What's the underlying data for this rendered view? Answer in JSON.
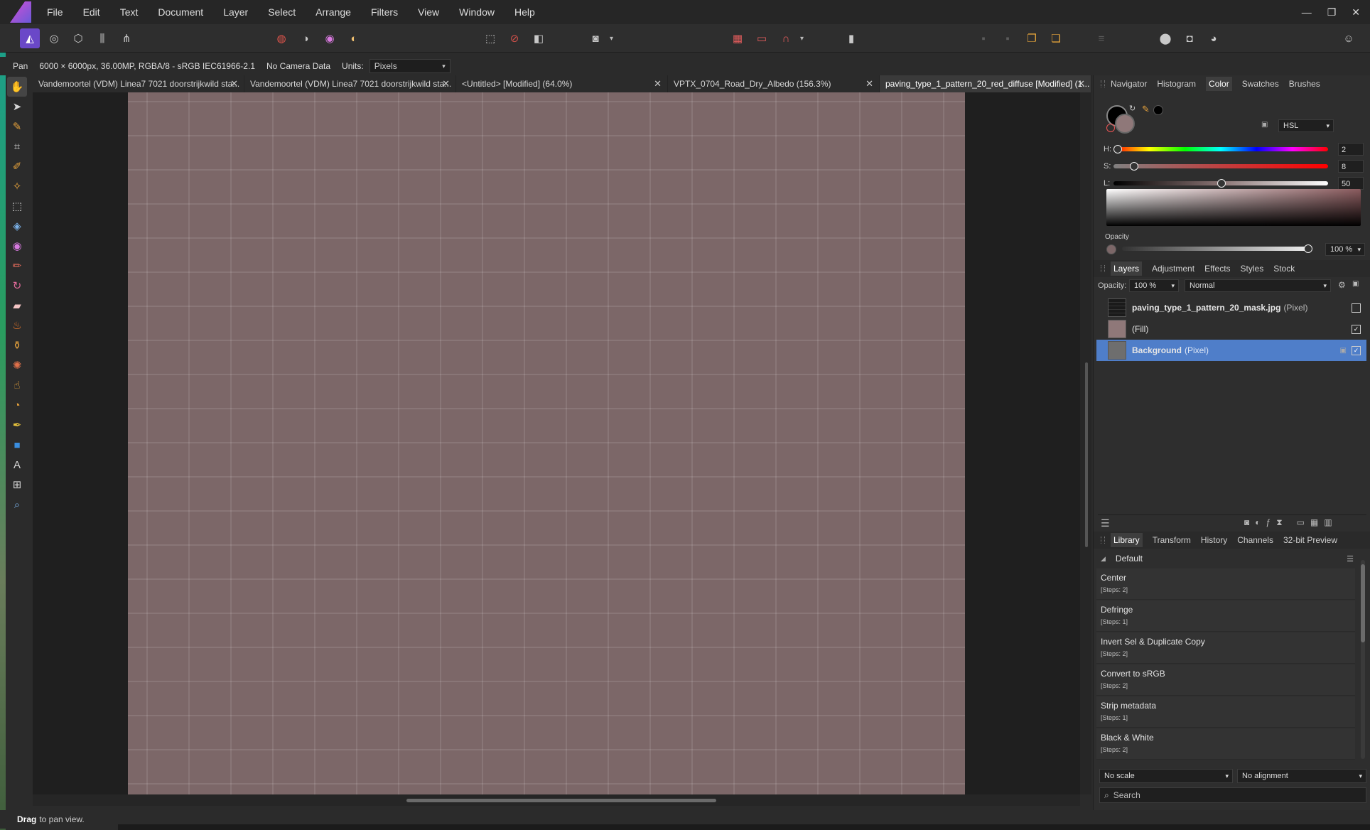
{
  "menubar": {
    "items": [
      "File",
      "Edit",
      "Text",
      "Document",
      "Layer",
      "Select",
      "Arrange",
      "Filters",
      "View",
      "Window",
      "Help"
    ],
    "window_controls": [
      "—",
      "❐",
      "✕"
    ]
  },
  "contextbar": {
    "tool": "Pan",
    "doc_info": "6000 × 6000px, 36.00MP, RGBA/8 - sRGB IEC61966-2.1",
    "camera": "No Camera Data",
    "units_label": "Units:",
    "units_value": "Pixels"
  },
  "tabs": [
    {
      "label": "Vandemoortel (VDM) Linea7 7021 doorstrijkwild sta...",
      "active": false
    },
    {
      "label": "Vandemoortel (VDM) Linea7 7021 doorstrijkwild sta...",
      "active": false
    },
    {
      "label": "<Untitled> [Modified] (64.0%)",
      "active": false
    },
    {
      "label": "VPTX_0704_Road_Dry_Albedo (156.3%)",
      "active": false
    },
    {
      "label": "paving_type_1_pattern_20_red_diffuse [Modified] (1...",
      "active": true
    }
  ],
  "tab_close_glyph": "✕",
  "status": {
    "bold": "Drag",
    "text": "to pan view."
  },
  "color_panel": {
    "tabs": [
      "Navigator",
      "Histogram",
      "Color",
      "Swatches",
      "Brushes"
    ],
    "active_tab": "Color",
    "mode": "HSL",
    "h_label": "H:",
    "h_value": "2",
    "h_fraction": 0.0,
    "s_label": "S:",
    "s_value": "8",
    "s_fraction": 0.08,
    "l_label": "L:",
    "l_value": "50",
    "l_fraction": 0.5,
    "opacity_label": "Opacity",
    "opacity_value": "100 %",
    "fill_color": "#8f7879"
  },
  "layers_panel": {
    "tabs": [
      "Layers",
      "Adjustment",
      "Effects",
      "Styles",
      "Stock"
    ],
    "active_tab": "Layers",
    "opacity_label": "Opacity:",
    "opacity_value": "100 %",
    "blend_mode": "Normal",
    "layers": [
      {
        "name": "paving_type_1_pattern_20_mask.jpg",
        "kind": "(Pixel)",
        "visible": false,
        "selected": false,
        "bold": true
      },
      {
        "name": "(Fill)",
        "kind": "",
        "visible": true,
        "selected": false,
        "bold": false
      },
      {
        "name": "Background",
        "kind": "(Pixel)",
        "visible": true,
        "selected": true,
        "bold": true,
        "locked": true
      }
    ]
  },
  "library_panel": {
    "tabs": [
      "Library",
      "Transform",
      "History",
      "Channels",
      "32-bit Preview"
    ],
    "active_tab": "Library",
    "category": "Default",
    "macros": [
      {
        "name": "Center",
        "steps": "[Steps: 2]"
      },
      {
        "name": "Defringe",
        "steps": "[Steps: 1]"
      },
      {
        "name": "Invert Sel & Duplicate Copy",
        "steps": "[Steps: 2]"
      },
      {
        "name": "Convert to sRGB",
        "steps": "[Steps: 2]"
      },
      {
        "name": "Strip metadata",
        "steps": "[Steps: 1]"
      },
      {
        "name": "Black & White",
        "steps": "[Steps: 2]"
      }
    ],
    "scale_option": "No scale",
    "alignment_option": "No alignment",
    "search_placeholder": "Search"
  },
  "colors": {
    "accent": "#4f7ec9",
    "brick": "#7c6768",
    "background": "#2b2b2b"
  }
}
